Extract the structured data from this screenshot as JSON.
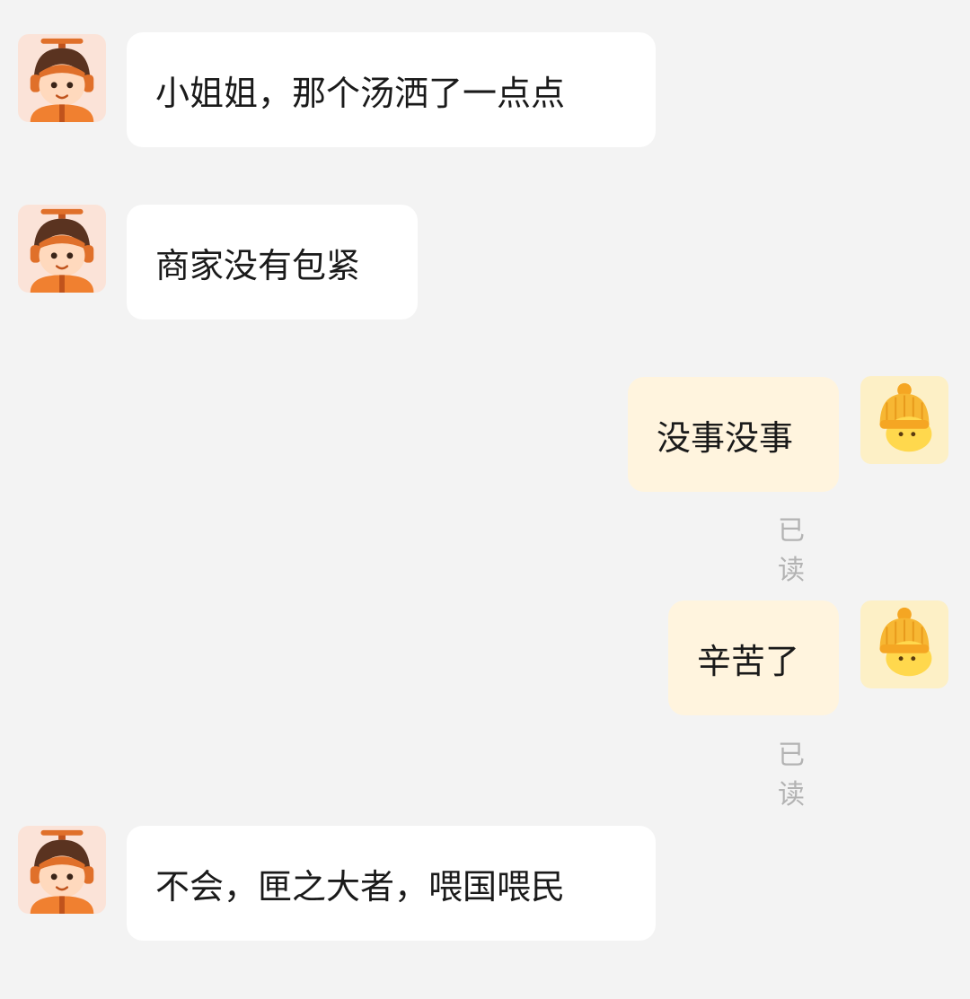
{
  "messages": [
    {
      "sender": "rider",
      "text": "小姐姐，那个汤洒了一点点"
    },
    {
      "sender": "rider",
      "text": "商家没有包紧"
    },
    {
      "sender": "me",
      "text": "没事没事",
      "status": "已读"
    },
    {
      "sender": "me",
      "text": "辛苦了",
      "status": "已读"
    },
    {
      "sender": "rider",
      "text": "不会，匣之大者，喂国喂民"
    }
  ],
  "avatars": {
    "rider": "delivery-rider-avatar-icon",
    "me": "yellow-hat-user-avatar-icon"
  },
  "colors": {
    "background": "#f3f3f3",
    "incoming_bubble": "#ffffff",
    "outgoing_bubble": "#fff4de",
    "read_text": "#b3b3b3"
  }
}
